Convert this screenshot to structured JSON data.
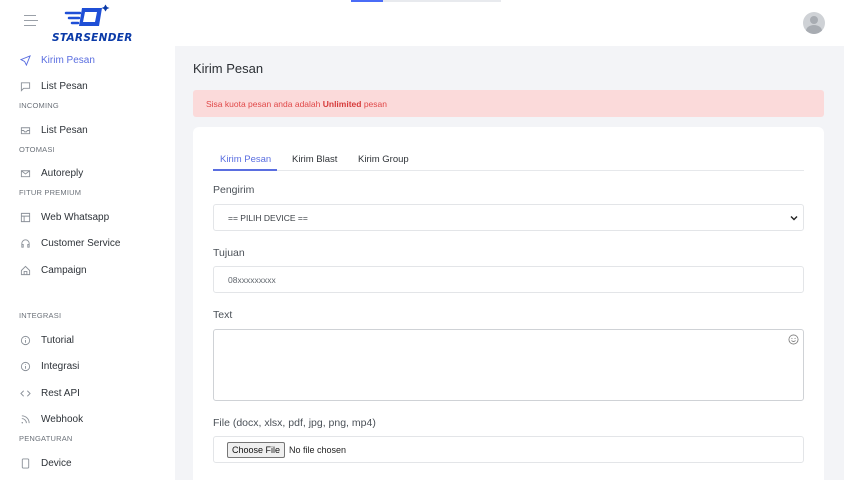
{
  "header": {
    "brand": "STARSENDER",
    "progress_fraction": 0.21
  },
  "sidebar": {
    "items": [
      {
        "label": "Kirim Pesan",
        "icon": "send-icon",
        "active": true
      },
      {
        "label": "List Pesan",
        "icon": "chat-icon"
      },
      {
        "label": "List Pesan",
        "icon": "inbox-icon"
      },
      {
        "label": "Autoreply",
        "icon": "mail-icon"
      },
      {
        "label": "Web Whatsapp",
        "icon": "window-icon"
      },
      {
        "label": "Customer Service",
        "icon": "headset-icon"
      },
      {
        "label": "Campaign",
        "icon": "home-icon"
      },
      {
        "label": "Tutorial",
        "icon": "info-icon"
      },
      {
        "label": "Integrasi",
        "icon": "info-icon"
      },
      {
        "label": "Rest API",
        "icon": "code-icon"
      },
      {
        "label": "Webhook",
        "icon": "rss-icon"
      },
      {
        "label": "Device",
        "icon": "device-icon"
      }
    ],
    "sections": {
      "incoming": "INCOMING",
      "otomasi": "OTOMASI",
      "fitur_premium": "FITUR PREMIUM",
      "integrasi": "INTEGRASI",
      "pengaturan": "PENGATURAN"
    }
  },
  "main": {
    "title": "Kirim Pesan",
    "alert": {
      "prefix": "Sisa kuota pesan anda adalah ",
      "highlight": "Unlimited",
      "suffix": " pesan"
    },
    "tabs": [
      {
        "label": "Kirim Pesan",
        "active": true
      },
      {
        "label": "Kirim Blast"
      },
      {
        "label": "Kirim Group"
      }
    ],
    "form": {
      "pengirim_label": "Pengirim",
      "pengirim_value": "== PILIH DEVICE ==",
      "tujuan_label": "Tujuan",
      "tujuan_placeholder": "08xxxxxxxxx",
      "text_label": "Text",
      "file_label": "File (docx, xlsx, pdf, jpg, png, mp4)",
      "file_button": "Choose File",
      "file_status": "No file chosen"
    }
  },
  "colors": {
    "accent": "#5a6ee0",
    "alert_bg": "#fbdada",
    "alert_text": "#e04848",
    "brand_blue": "#0a3aa8"
  }
}
